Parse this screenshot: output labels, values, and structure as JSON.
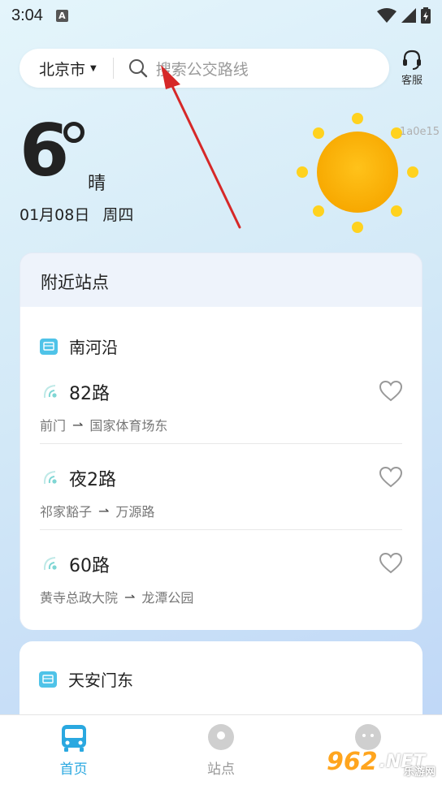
{
  "status_bar": {
    "time": "3:04",
    "notification_letter": "A"
  },
  "search": {
    "city": "北京市",
    "placeholder": "搜索公交路线",
    "service_label": "客服"
  },
  "weather": {
    "temperature": "6",
    "condition": "晴",
    "date": "01月08日",
    "weekday": "周四",
    "code_text": "1a0e15"
  },
  "nearby": {
    "title": "附近站点",
    "stops": [
      {
        "name": "南河沿",
        "routes": [
          {
            "name": "82路",
            "from": "前门",
            "to": "国家体育场东"
          },
          {
            "name": "夜2路",
            "from": "祁家豁子",
            "to": "万源路"
          },
          {
            "name": "60路",
            "from": "黄寺总政大院",
            "to": "龙潭公园"
          }
        ]
      },
      {
        "name": "天安门东"
      }
    ]
  },
  "bottom_nav": {
    "items": [
      {
        "label": "首页",
        "icon": "bus-icon",
        "active": true
      },
      {
        "label": "站点",
        "icon": "location-pin-icon",
        "active": false
      },
      {
        "label": "",
        "icon": "profile-icon",
        "active": false
      }
    ]
  },
  "watermark": {
    "number": "962",
    "suffix": ".NET",
    "sub": "乐游网"
  },
  "colors": {
    "accent": "#2aa8e0",
    "stop_icon": "#4fc3e8",
    "signal": "#7fd6d4",
    "sun": "#f7b900",
    "annotation_arrow": "#d62828"
  }
}
